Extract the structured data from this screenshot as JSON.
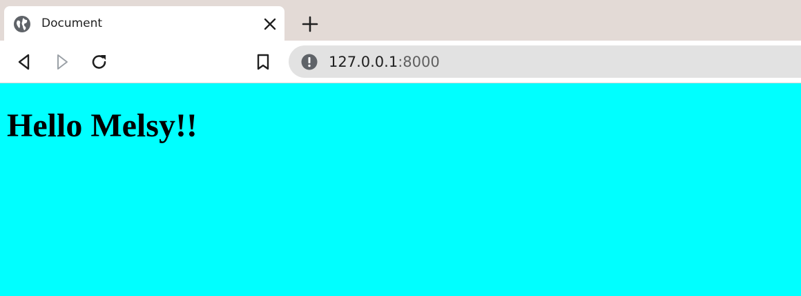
{
  "tab": {
    "title": "Document",
    "favicon_icon": "globe-icon",
    "close_icon": "close-icon"
  },
  "new_tab_icon": "plus-icon",
  "toolbar": {
    "back_icon": "back-icon",
    "forward_icon": "forward-icon",
    "reload_icon": "reload-icon",
    "bookmark_icon": "bookmark-icon"
  },
  "address_bar": {
    "security_icon": "info-icon",
    "url_host": "127.0.0.1",
    "url_port": ":8000"
  },
  "page": {
    "heading": "Hello Melsy!!",
    "background_color": "#00ffff"
  },
  "colors": {
    "tab_strip": "#e3dad6",
    "omnibox": "#e2e2e2"
  }
}
